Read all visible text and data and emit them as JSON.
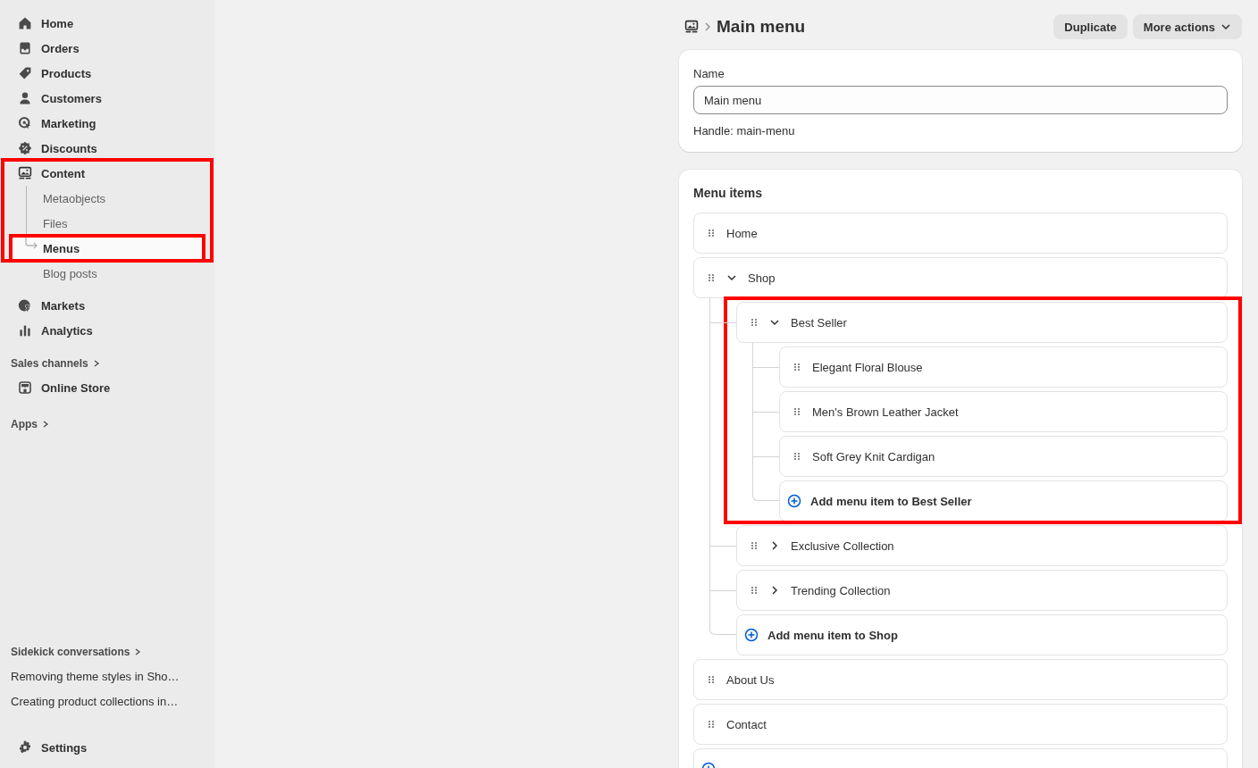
{
  "sidebar": {
    "nav": [
      {
        "label": "Home",
        "highlighted": false
      },
      {
        "label": "Orders",
        "highlighted": false
      },
      {
        "label": "Products",
        "highlighted": false
      },
      {
        "label": "Customers",
        "highlighted": false
      },
      {
        "label": "Marketing",
        "highlighted": false
      },
      {
        "label": "Discounts",
        "highlighted": false
      },
      {
        "label": "Content",
        "highlighted": true,
        "children": [
          {
            "label": "Metaobjects",
            "selected": false,
            "highlighted": false
          },
          {
            "label": "Files",
            "selected": false,
            "highlighted": false
          },
          {
            "label": "Menus",
            "selected": true,
            "highlighted": true
          },
          {
            "label": "Blog posts",
            "selected": false,
            "highlighted": false
          }
        ]
      },
      {
        "label": "Markets",
        "highlighted": false
      },
      {
        "label": "Analytics",
        "highlighted": false
      }
    ],
    "sales_channels": {
      "title": "Sales channels",
      "items": [
        {
          "label": "Online Store"
        }
      ]
    },
    "apps": {
      "title": "Apps"
    },
    "sidekick": {
      "title": "Sidekick conversations",
      "items": [
        "Removing theme styles in Sho…",
        "Creating product collections in…"
      ]
    },
    "settings": {
      "label": "Settings"
    }
  },
  "page": {
    "title": "Main menu",
    "actions": [
      {
        "label": "Duplicate",
        "kind": "button"
      },
      {
        "label": "More actions",
        "kind": "menu"
      }
    ]
  },
  "name_card": {
    "label": "Name",
    "value": "Main menu",
    "handle": "Handle: main-menu"
  },
  "menu_items": {
    "title": "Menu items",
    "items": [
      {
        "kind": "item",
        "label": "Home",
        "highlighted": false
      },
      {
        "kind": "item",
        "label": "Shop",
        "expanded": true,
        "highlighted": false,
        "children": [
          {
            "kind": "item",
            "label": "Best Seller",
            "expanded": true,
            "highlighted": true,
            "children": [
              {
                "kind": "item",
                "label": "Elegant Floral Blouse",
                "highlighted": false
              },
              {
                "kind": "item",
                "label": "Men's Brown Leather Jacket",
                "highlighted": false
              },
              {
                "kind": "item",
                "label": "Soft Grey Knit Cardigan",
                "highlighted": false
              },
              {
                "kind": "add",
                "label": "Add menu item to Best Seller",
                "highlighted": false
              }
            ]
          },
          {
            "kind": "item",
            "label": "Exclusive Collection",
            "expanded": false,
            "highlighted": false
          },
          {
            "kind": "item",
            "label": "Trending Collection",
            "expanded": false,
            "highlighted": false
          },
          {
            "kind": "add",
            "label": "Add menu item to Shop",
            "highlighted": false
          }
        ]
      },
      {
        "kind": "item",
        "label": "About Us",
        "highlighted": false
      },
      {
        "kind": "item",
        "label": "Contact",
        "highlighted": false
      },
      {
        "kind": "add",
        "highlighted": false
      }
    ]
  }
}
